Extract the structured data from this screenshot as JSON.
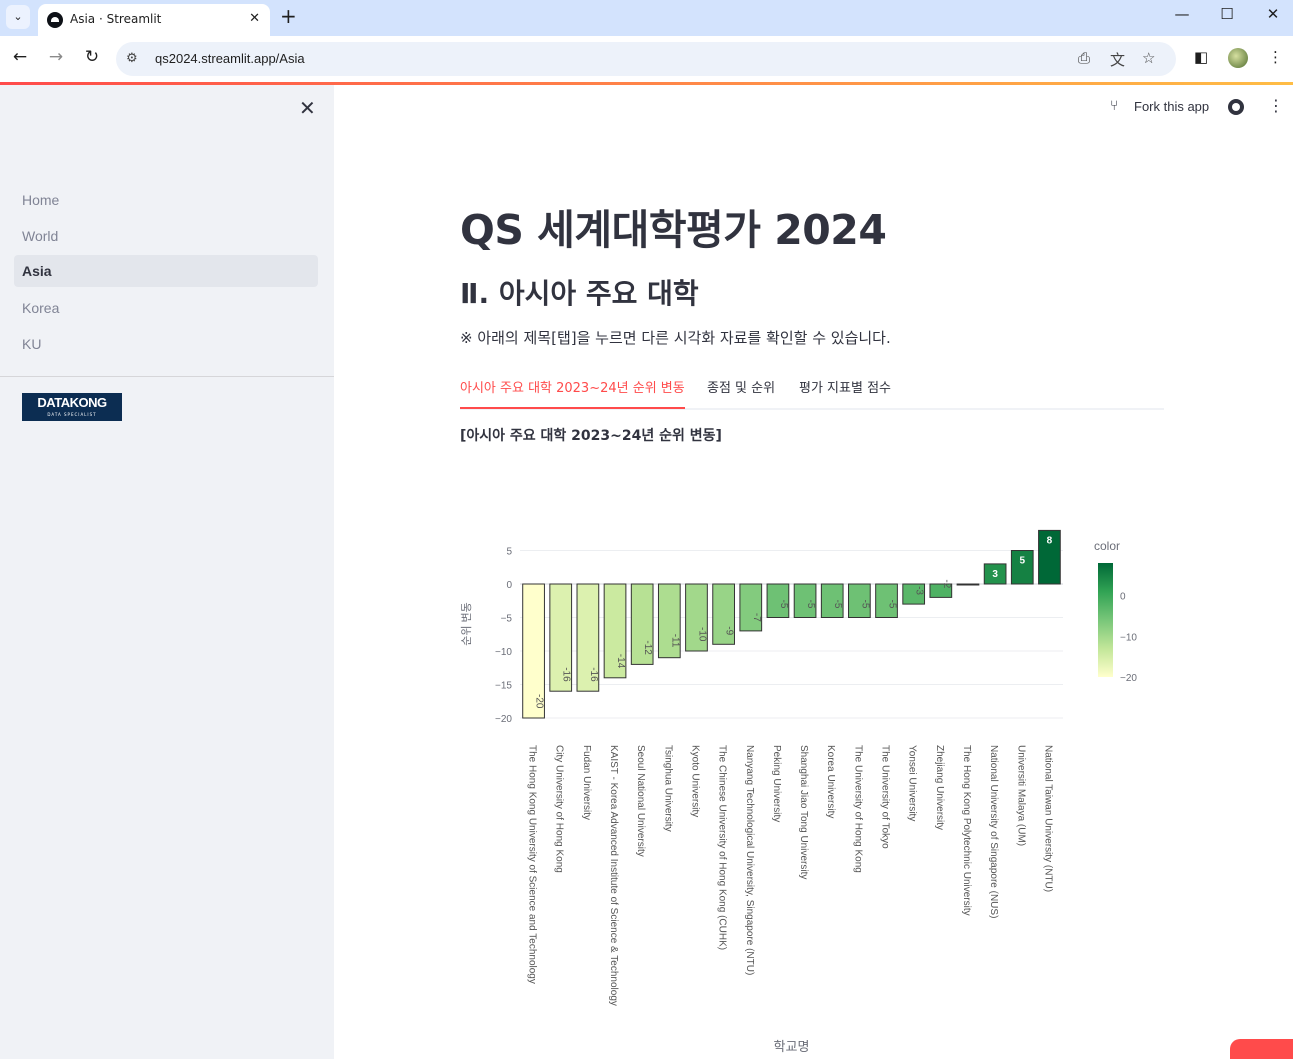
{
  "browser": {
    "tab_title": "Asia · Streamlit",
    "url": "qs2024.streamlit.app/Asia",
    "icons": {
      "tab_menu": "chevron-down-icon",
      "tab_close": "close-icon",
      "new_tab": "plus-icon",
      "back": "arrow-left-icon",
      "forward": "arrow-right-icon",
      "reload": "reload-icon",
      "site_info": "tune-icon",
      "install": "install-icon",
      "translate": "translate-icon",
      "bookmark": "star-icon",
      "side_panel": "side-panel-icon",
      "profile": "profile-avatar",
      "menu": "more-vertical-icon"
    }
  },
  "sidebar": {
    "items": [
      {
        "label": "Home",
        "active": false
      },
      {
        "label": "World",
        "active": false
      },
      {
        "label": "Asia",
        "active": true
      },
      {
        "label": "Korea",
        "active": false
      },
      {
        "label": "KU",
        "active": false
      }
    ],
    "logo": {
      "text": "DATAKONG",
      "subtext": "DATA SPECIALIST"
    }
  },
  "header": {
    "fork_label": "Fork this app",
    "icons": {
      "fork": "fork-icon",
      "github": "github-icon",
      "more": "more-vertical-icon"
    }
  },
  "main": {
    "title": "QS 세계대학평가 2024",
    "subtitle": "Ⅱ. 아시아 주요 대학",
    "note": "※ 아래의 제목[탭]을 누르면 다른 시각화 자료를 확인할 수 있습니다.",
    "tabs": [
      {
        "label": "아시아 주요 대학 2023~24년 순위 변동",
        "active": true
      },
      {
        "label": "종점 및 순위",
        "active": false
      },
      {
        "label": "평가 지표별 점수",
        "active": false
      }
    ],
    "section_title": "[아시아 주요 대학 2023~24년 순위 변동]"
  },
  "colors": {
    "accent": "#ff4b4b",
    "sidebar_bg": "#f0f2f6",
    "text": "#31333f"
  },
  "chart_data": {
    "type": "bar",
    "categories": [
      "The Hong Kong University of Science and Technology",
      "City University of Hong Kong",
      "Fudan University",
      "KAIST - Korea Advanced Institute of Science & Technology",
      "Seoul National University",
      "Tsinghua University",
      "Kyoto University",
      "The Chinese University of Hong Kong (CUHK)",
      "Nanyang Technological University, Singapore (NTU)",
      "Peking University",
      "Shanghai Jiao Tong University",
      "Korea University",
      "The University of Hong Kong",
      "The University of Tokyo",
      "Yonsei University",
      "Zhejiang University",
      "The Hong Kong Polytechnic University",
      "National University of Singapore (NUS)",
      "Universiti Malaya (UM)",
      "National Taiwan University (NTU)"
    ],
    "values": [
      -20,
      -16,
      -16,
      -14,
      -12,
      -11,
      -10,
      -9,
      -7,
      -5,
      -5,
      -5,
      -5,
      -5,
      -3,
      -2,
      0,
      3,
      5,
      8
    ],
    "value_labels": [
      "-20",
      "-16",
      "-16",
      "-14",
      "-12",
      "-11",
      "-10",
      "-9",
      "-7",
      "-5",
      "-5",
      "-5",
      "-5",
      "-5",
      "-3",
      "-2",
      "",
      "3",
      "5",
      "8"
    ],
    "xlabel": "학교명",
    "ylabel": "순위 변동",
    "ylim": [
      -20,
      8
    ],
    "yticks": [
      5,
      0,
      -5,
      -10,
      -15,
      -20
    ],
    "tick_labels": [
      "5",
      "0",
      "−5",
      "−10",
      "−15",
      "−20"
    ],
    "colorbar": {
      "title": "color",
      "ticks": [
        0,
        -10,
        -20
      ],
      "tick_labels": [
        "0",
        "−10",
        "−20"
      ],
      "range": [
        -20,
        8
      ],
      "scale": [
        "#ffffcc",
        "#c2e699",
        "#78c679",
        "#31a354",
        "#006837"
      ]
    },
    "grid": true
  }
}
